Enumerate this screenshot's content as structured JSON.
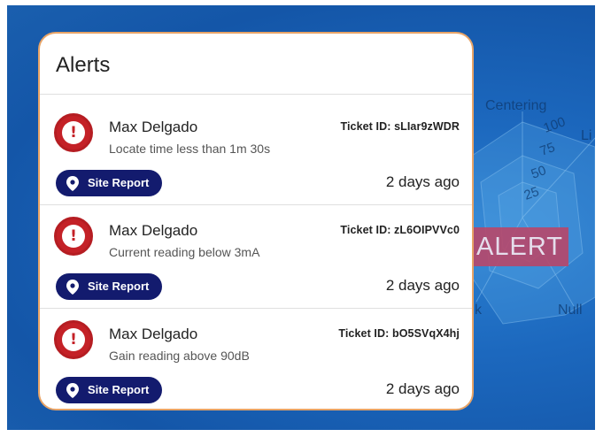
{
  "background": {
    "radar_labels": [
      "Centering",
      "100",
      "Li",
      "75",
      "50",
      "25",
      "Null",
      "k"
    ],
    "alert_badge": "ALERT"
  },
  "panel": {
    "title": "Alerts",
    "alerts": [
      {
        "name": "Max Delgado",
        "description": "Locate time less than 1m 30s",
        "ticket_label": "Ticket ID:",
        "ticket_id": "sLIar9zWDR",
        "button_label": "Site Report",
        "time_ago": "2 days ago"
      },
      {
        "name": "Max Delgado",
        "description": "Current reading below 3mA",
        "ticket_label": "Ticket ID:",
        "ticket_id": "zL6OIPVVc0",
        "button_label": "Site Report",
        "time_ago": "2 days ago"
      },
      {
        "name": "Max Delgado",
        "description": "Gain reading above 90dB",
        "ticket_label": "Ticket ID:",
        "ticket_id": "bO5SVqX4hj",
        "button_label": "Site Report",
        "time_ago": "2 days ago"
      }
    ]
  },
  "colors": {
    "accent_border": "#e8a467",
    "alert_red": "#c42127",
    "button_navy": "#131b6e",
    "badge_pink": "#b8476a"
  },
  "icons": [
    "exclamation-circle-icon",
    "map-pin-icon"
  ]
}
